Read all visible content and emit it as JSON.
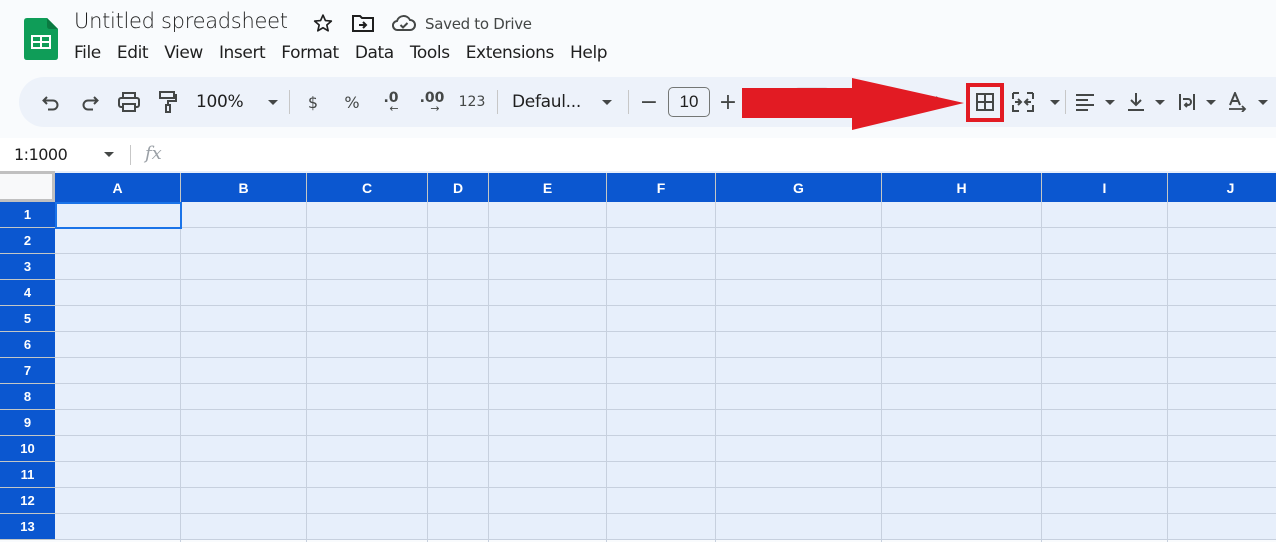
{
  "app": {
    "title": "Untitled spreadsheet",
    "save_status": "Saved to Drive",
    "icons": [
      "sheets-logo-icon",
      "star-icon",
      "move-folder-icon",
      "cloud-saved-icon"
    ]
  },
  "menu": [
    "File",
    "Edit",
    "View",
    "Insert",
    "Format",
    "Data",
    "Tools",
    "Extensions",
    "Help"
  ],
  "toolbar": {
    "zoom": "100%",
    "currency": "$",
    "percent": "%",
    "decrease_decimal": ".0",
    "increase_decimal": ".00",
    "more_formats": "123",
    "font": "Defaul...",
    "font_size_minus": "−",
    "font_size": "10",
    "font_size_plus": "+",
    "highlighted_button": "borders"
  },
  "formula_bar": {
    "name_box": "1:1000",
    "fx": "fx",
    "value": ""
  },
  "grid": {
    "columns": [
      "A",
      "B",
      "C",
      "D",
      "E",
      "F",
      "G",
      "H",
      "I",
      "J"
    ],
    "rows": [
      "1",
      "2",
      "3",
      "4",
      "5",
      "6",
      "7",
      "8",
      "9",
      "10",
      "11",
      "12",
      "13"
    ],
    "active_cell": "A1"
  },
  "annotation": {
    "type": "red-arrow",
    "points_to": "borders-button",
    "color": "#e21b23"
  },
  "colors": {
    "header_selected": "#0b57d0",
    "selection_fill": "#e7effb",
    "toolbar_bg": "#edf2fa",
    "sheets_green": "#0f9d58"
  }
}
